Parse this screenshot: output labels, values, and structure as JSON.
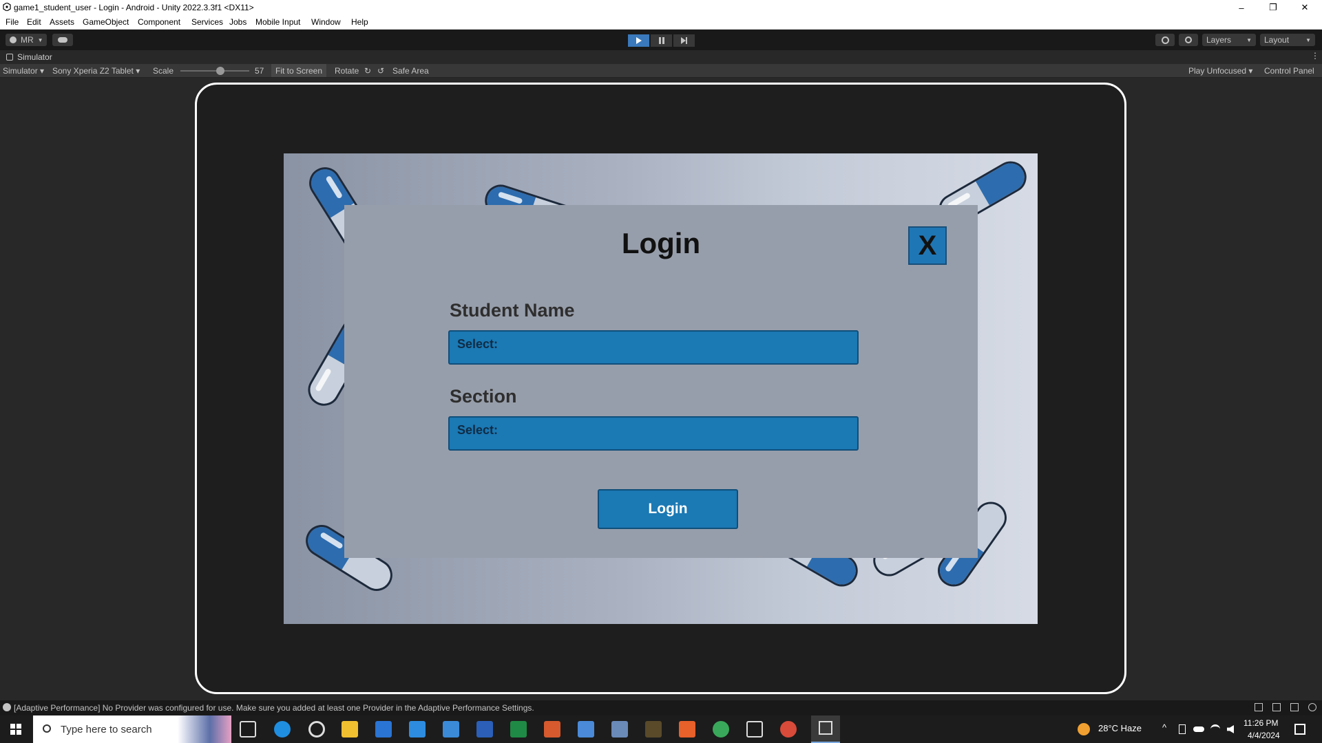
{
  "window": {
    "title": "game1_student_user - Login - Android - Unity 2022.3.3f1 <DX11>",
    "controls": {
      "minimize": "–",
      "restore": "❐",
      "close": "✕"
    }
  },
  "menu": [
    "File",
    "Edit",
    "Assets",
    "GameObject",
    "Component",
    "Services",
    "Jobs",
    "Mobile Input",
    "Window",
    "Help"
  ],
  "toolbar": {
    "account_label": "MR",
    "layers_label": "Layers",
    "layout_label": "Layout"
  },
  "simulator_tab": {
    "label": "Simulator"
  },
  "sim_toolbar": {
    "mode": "Simulator",
    "device": "Sony Xperia Z2 Tablet",
    "scale_label": "Scale",
    "scale_value": "57",
    "fit_to_screen": "Fit to Screen",
    "rotate": "Rotate",
    "safe_area": "Safe Area",
    "play_mode": "Play Unfocused",
    "control_panel": "Control Panel"
  },
  "game": {
    "title": "Login",
    "close_label": "X",
    "student_name_label": "Student Name",
    "student_name_value": "Select:",
    "section_label": "Section",
    "section_value": "Select:",
    "login_button": "Login"
  },
  "status": {
    "message": "[Adaptive Performance] No Provider was configured for use. Make sure you added at least one Provider in the Adaptive Performance Settings."
  },
  "taskbar": {
    "search_placeholder": "Type here to search",
    "weather": "28°C  Haze",
    "time": "11:26 PM",
    "date": "4/4/2024"
  },
  "colors": {
    "accent_blue": "#1b79b4",
    "play_active": "#3a79bb",
    "editor_bg": "#282828"
  }
}
